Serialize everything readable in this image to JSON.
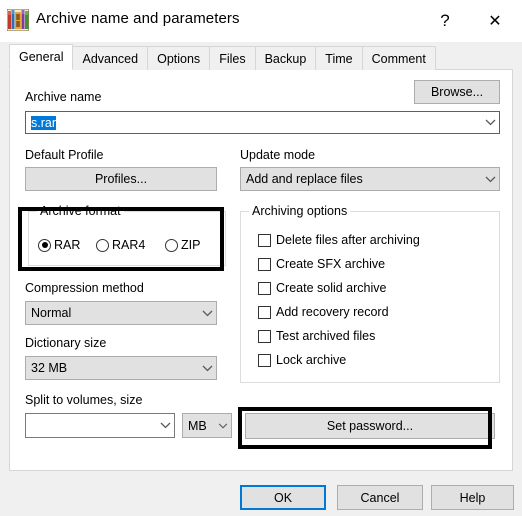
{
  "window": {
    "title": "Archive name and parameters",
    "icon": "winrar-books-icon",
    "help_button": "?",
    "close_button": "✕"
  },
  "tabs": [
    {
      "label": "General",
      "active": true
    },
    {
      "label": "Advanced",
      "active": false
    },
    {
      "label": "Options",
      "active": false
    },
    {
      "label": "Files",
      "active": false
    },
    {
      "label": "Backup",
      "active": false
    },
    {
      "label": "Time",
      "active": false
    },
    {
      "label": "Comment",
      "active": false
    }
  ],
  "archive_name": {
    "label": "Archive name",
    "value": "s.rar",
    "selected": true,
    "browse_label": "Browse..."
  },
  "default_profile": {
    "label": "Default Profile",
    "button_label": "Profiles..."
  },
  "update_mode": {
    "label": "Update mode",
    "value": "Add and replace files"
  },
  "archive_format": {
    "legend": "Archive format",
    "highlighted": true,
    "options": [
      {
        "label": "RAR",
        "checked": true
      },
      {
        "label": "RAR4",
        "checked": false
      },
      {
        "label": "ZIP",
        "checked": false
      }
    ]
  },
  "compression_method": {
    "label": "Compression method",
    "value": "Normal"
  },
  "dictionary_size": {
    "label": "Dictionary size",
    "value": "32 MB"
  },
  "split_volumes": {
    "label": "Split to volumes, size",
    "value": "",
    "unit": "MB"
  },
  "archiving_options": {
    "legend": "Archiving options",
    "items": [
      {
        "label": "Delete files after archiving",
        "checked": false
      },
      {
        "label": "Create SFX archive",
        "checked": false
      },
      {
        "label": "Create solid archive",
        "checked": false
      },
      {
        "label": "Add recovery record",
        "checked": false
      },
      {
        "label": "Test archived files",
        "checked": false
      },
      {
        "label": "Lock archive",
        "checked": false
      }
    ]
  },
  "set_password": {
    "label": "Set password...",
    "highlighted": true
  },
  "footer": {
    "ok_label": "OK",
    "cancel_label": "Cancel",
    "help_label": "Help"
  },
  "colors": {
    "accent": "#0078d7",
    "dialog_bg": "#f0f0f0",
    "page_bg": "#ffffff",
    "control_bg": "#e1e1e1",
    "highlight_box": "#000000",
    "selection_bg": "#0078d7"
  }
}
